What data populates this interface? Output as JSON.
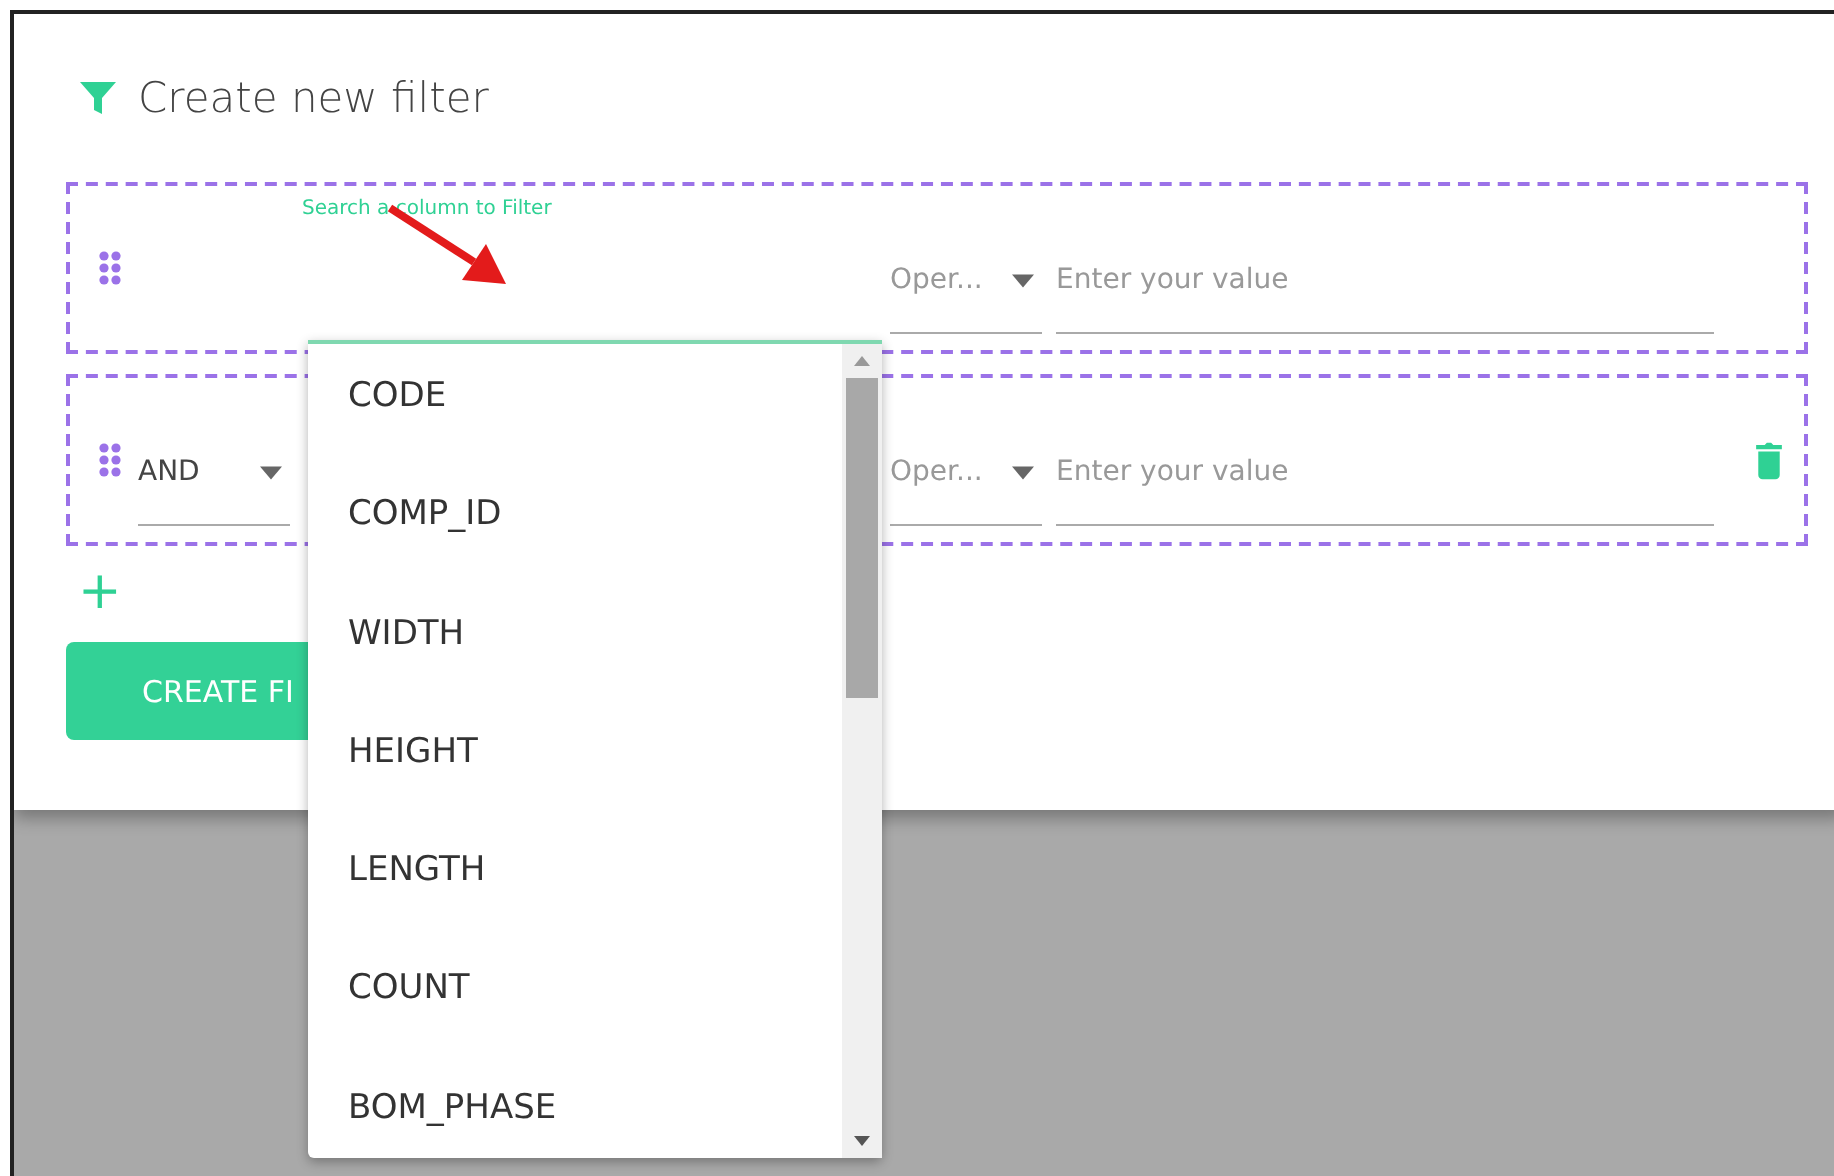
{
  "dialog": {
    "title": "Create new filter"
  },
  "filters": [
    {
      "column_label": "Search a column to Filter",
      "operator": "Oper...",
      "value_placeholder": "Enter your value",
      "deletable": false
    },
    {
      "connector": "AND",
      "operator": "Oper...",
      "value_placeholder": "Enter your value",
      "deletable": true
    }
  ],
  "add_button": "+",
  "create_button": "CREATE FI",
  "column_dropdown": {
    "options": [
      "CODE",
      "COMP_ID",
      "WIDTH",
      "HEIGHT",
      "LENGTH",
      "COUNT",
      "BOM_PHASE"
    ]
  }
}
